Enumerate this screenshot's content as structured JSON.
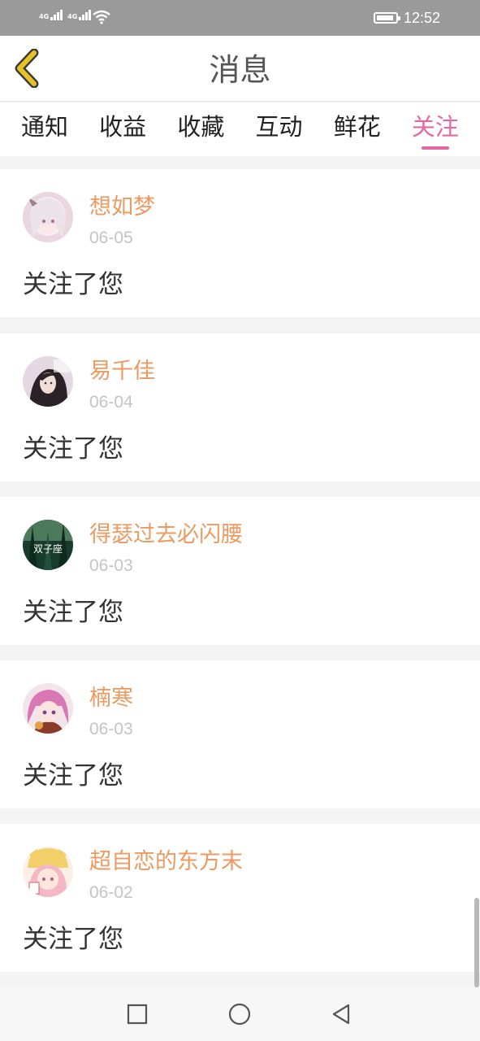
{
  "status_bar": {
    "network_left": "4G",
    "network_right": "4G",
    "time": "12:52"
  },
  "header": {
    "title": "消息",
    "back_icon": "chevron-left-icon",
    "accent": "#e6c227"
  },
  "tabs": [
    {
      "label": "通知"
    },
    {
      "label": "收益"
    },
    {
      "label": "收藏"
    },
    {
      "label": "互动"
    },
    {
      "label": "鲜花"
    },
    {
      "label": "关注",
      "active": true
    }
  ],
  "colors": {
    "active_tab": "#e766a2",
    "username": "#ec9a62",
    "date": "#c4c4c4"
  },
  "messages": [
    {
      "username": "想如梦",
      "date": "06-05",
      "text": "关注了您"
    },
    {
      "username": "易千佳",
      "date": "06-04",
      "text": "关注了您"
    },
    {
      "username": "得瑟过去必闪腰",
      "date": "06-03",
      "text": "关注了您",
      "avatar_text": "双子座"
    },
    {
      "username": "楠寒",
      "date": "06-03",
      "text": "关注了您"
    },
    {
      "username": "超自恋的东方末",
      "date": "06-02",
      "text": "关注了您"
    }
  ],
  "nav_bar": {
    "buttons": [
      "recent-apps-icon",
      "home-icon",
      "back-icon"
    ]
  }
}
